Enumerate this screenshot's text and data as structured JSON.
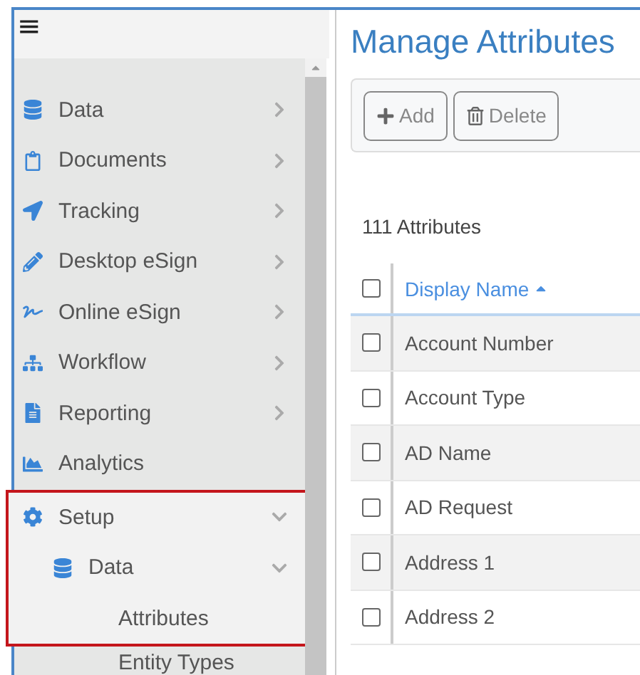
{
  "menu_button": "≡",
  "sidebar": {
    "items": [
      {
        "label": "Data",
        "kind": "group",
        "expanded": false
      },
      {
        "label": "Documents",
        "kind": "group",
        "expanded": false
      },
      {
        "label": "Tracking",
        "kind": "group",
        "expanded": false
      },
      {
        "label": "Desktop eSign",
        "kind": "group",
        "expanded": false
      },
      {
        "label": "Online eSign",
        "kind": "group",
        "expanded": false
      },
      {
        "label": "Workflow",
        "kind": "group",
        "expanded": false
      },
      {
        "label": "Reporting",
        "kind": "group",
        "expanded": false
      },
      {
        "label": "Analytics",
        "kind": "link"
      },
      {
        "label": "Setup",
        "kind": "group",
        "expanded": true,
        "children": [
          {
            "label": "Data",
            "kind": "group",
            "expanded": true,
            "children": [
              {
                "label": "Attributes"
              },
              {
                "label": "Entity Types"
              }
            ]
          }
        ]
      }
    ]
  },
  "page": {
    "title": "Manage Attributes",
    "toolbar": [
      {
        "label": "Add",
        "kind": "add"
      },
      {
        "label": "Delete",
        "kind": "delete"
      }
    ],
    "count": "111 Attributes",
    "table": {
      "all_checked": false,
      "columns": [
        {
          "label": "Display Name",
          "sorted": true
        }
      ],
      "rows": [
        {
          "checked": false,
          "cells": [
            "Account Number"
          ]
        },
        {
          "checked": false,
          "cells": [
            "Account Type"
          ]
        },
        {
          "checked": false,
          "cells": [
            "AD Name"
          ]
        },
        {
          "checked": false,
          "cells": [
            "AD Request"
          ]
        },
        {
          "checked": false,
          "cells": [
            "Address 1"
          ]
        },
        {
          "checked": false,
          "cells": [
            "Address 2"
          ]
        }
      ]
    }
  }
}
